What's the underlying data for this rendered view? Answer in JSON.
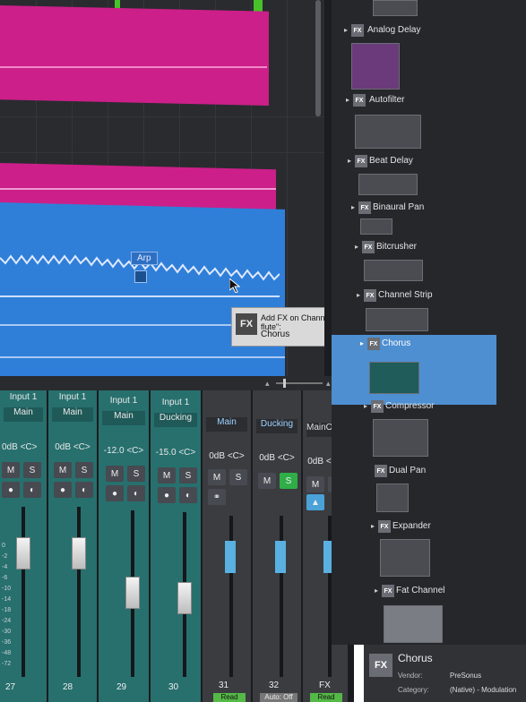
{
  "arrange": {
    "arp_label": "Arp",
    "tooltip": {
      "fx_badge": "FX",
      "line1": "Add FX on Channel \"Glitch flute\":",
      "line2": "Chorus"
    },
    "colors": {
      "pink": "#cc1f8a",
      "blue": "#2f7fd9",
      "green": "#47c22a"
    }
  },
  "mixer": {
    "channels": [
      {
        "input": "Input 1",
        "bus": "Main",
        "volume": "0dB",
        "pan": "<C>",
        "mute": "M",
        "solo": "S",
        "number": "27"
      },
      {
        "input": "Input 1",
        "bus": "Main",
        "volume": "0dB",
        "pan": "<C>",
        "mute": "M",
        "solo": "S",
        "number": "28"
      },
      {
        "input": "Input 1",
        "bus": "Main",
        "volume": "-12.0",
        "pan": "<C>",
        "mute": "M",
        "solo": "S",
        "number": "29"
      },
      {
        "input": "Input 1",
        "bus": "Ducking",
        "volume": "-15.0",
        "pan": "<C>",
        "mute": "M",
        "solo": "S",
        "number": "30"
      }
    ],
    "buses": [
      {
        "name": "Main",
        "volume": "0dB",
        "pan": "<C>",
        "mute": "M",
        "solo": "S",
        "number": "31",
        "auto": "Read"
      },
      {
        "name": "Ducking",
        "volume": "0dB",
        "pan": "<C>",
        "mute": "M",
        "solo": "S",
        "number": "32",
        "auto": "Auto: Off"
      },
      {
        "name": "MainOu...ight",
        "volume": "0dB",
        "pan": "<C>",
        "mute": "M",
        "solo": "S",
        "number": "FX",
        "auto": "Read"
      }
    ],
    "scale": [
      "0",
      "-2",
      "-4",
      "-6",
      "-10",
      "-14",
      "-18",
      "-24",
      "-30",
      "-36",
      "-48",
      "-72"
    ]
  },
  "browser": {
    "items": [
      {
        "name": "Analog Delay"
      },
      {
        "name": "Autofilter"
      },
      {
        "name": "Beat Delay"
      },
      {
        "name": "Binaural Pan"
      },
      {
        "name": "Bitcrusher"
      },
      {
        "name": "Channel Strip"
      },
      {
        "name": "Chorus"
      },
      {
        "name": "Compressor"
      },
      {
        "name": "Dual Pan"
      },
      {
        "name": "Expander"
      },
      {
        "name": "Fat Channel"
      }
    ],
    "fx_badge": "FX",
    "selected": "Chorus",
    "accent": "#4e8fd1"
  },
  "info": {
    "fx_badge": "FX",
    "name": "Chorus",
    "vendor_label": "Vendor:",
    "vendor": "PreSonus",
    "category_label": "Category:",
    "category": "(Native) - Modulation"
  }
}
